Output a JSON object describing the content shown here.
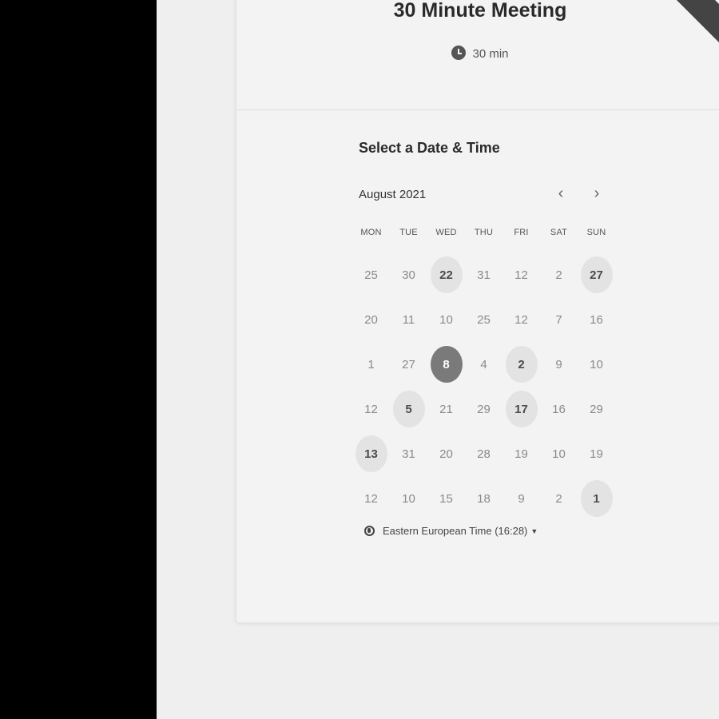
{
  "event": {
    "title": "30 Minute Meeting",
    "duration": "30 min"
  },
  "picker": {
    "heading": "Select a Date & Time",
    "month": "August 2021",
    "prev_label": "‹",
    "next_label": "›",
    "weekdays": [
      "MON",
      "TUE",
      "WED",
      "THU",
      "FRI",
      "SAT",
      "SUN"
    ],
    "weeks": [
      [
        {
          "n": "25"
        },
        {
          "n": "30"
        },
        {
          "n": "22",
          "state": "available"
        },
        {
          "n": "31"
        },
        {
          "n": "12"
        },
        {
          "n": "2"
        },
        {
          "n": "27",
          "state": "available"
        }
      ],
      [
        {
          "n": "20"
        },
        {
          "n": "11"
        },
        {
          "n": "10"
        },
        {
          "n": "25"
        },
        {
          "n": "12"
        },
        {
          "n": "7"
        },
        {
          "n": "16"
        }
      ],
      [
        {
          "n": "1"
        },
        {
          "n": "27"
        },
        {
          "n": "8",
          "state": "selected"
        },
        {
          "n": "4"
        },
        {
          "n": "2",
          "state": "available"
        },
        {
          "n": "9"
        },
        {
          "n": "10"
        }
      ],
      [
        {
          "n": "12"
        },
        {
          "n": "5",
          "state": "available"
        },
        {
          "n": "21"
        },
        {
          "n": "29"
        },
        {
          "n": "17",
          "state": "available"
        },
        {
          "n": "16"
        },
        {
          "n": "29"
        }
      ],
      [
        {
          "n": "13",
          "state": "available"
        },
        {
          "n": "31"
        },
        {
          "n": "20"
        },
        {
          "n": "28"
        },
        {
          "n": "19"
        },
        {
          "n": "10"
        },
        {
          "n": "19"
        }
      ],
      [
        {
          "n": "12"
        },
        {
          "n": "10"
        },
        {
          "n": "15"
        },
        {
          "n": "18"
        },
        {
          "n": "9"
        },
        {
          "n": "2"
        },
        {
          "n": "1",
          "state": "available"
        }
      ]
    ],
    "timezone": "Eastern European Time (16:28)",
    "timezone_caret": "▼"
  },
  "colors": {
    "selected": "#7a7a7a",
    "available": "#e3e3e3",
    "background": "#efefef"
  }
}
